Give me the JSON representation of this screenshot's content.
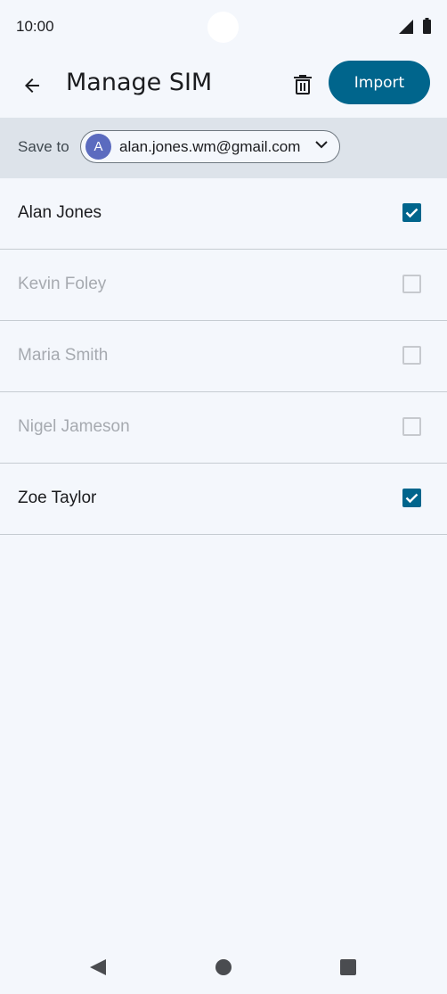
{
  "status_bar": {
    "time": "10:00",
    "icons": [
      "signal-icon",
      "battery-icon"
    ]
  },
  "app_bar": {
    "back_icon": "arrow-left-icon",
    "title": "Manage SIM",
    "delete_icon": "trash-icon",
    "import_label": "Import"
  },
  "save_to": {
    "label": "Save to",
    "account_initial": "A",
    "account_email": "alan.jones.wm@gmail.com",
    "chevron_icon": "chevron-down-icon"
  },
  "contacts": [
    {
      "name": "Alan Jones",
      "checked": true
    },
    {
      "name": "Kevin Foley",
      "checked": false
    },
    {
      "name": "Maria Smith",
      "checked": false
    },
    {
      "name": "Nigel Jameson",
      "checked": false
    },
    {
      "name": "Zoe Taylor",
      "checked": true
    }
  ],
  "colors": {
    "accent": "#00658c",
    "background": "#f4f7fc",
    "save_bar": "#dde3ea",
    "avatar": "#5b6bbf",
    "muted_text": "#a6aab0"
  },
  "nav_bar": {
    "icons": [
      "nav-back-icon",
      "nav-home-icon",
      "nav-recents-icon"
    ]
  }
}
